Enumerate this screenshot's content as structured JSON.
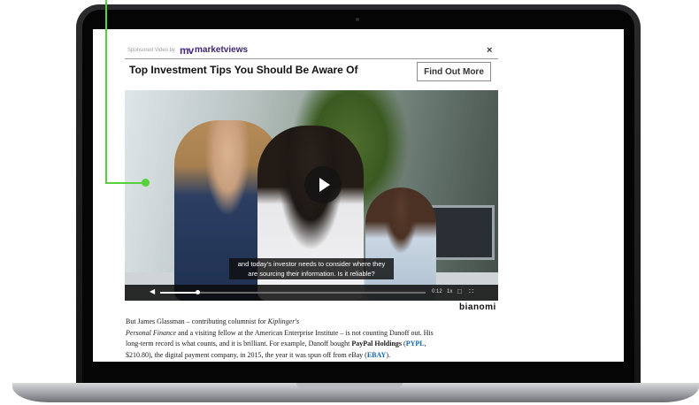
{
  "ad": {
    "sponsored_label": "Sponsored Video by",
    "logo_mark": "mv",
    "brand_name": "marketviews",
    "close_symbol": "×",
    "headline": "Top Investment Tips You Should Be Aware Of",
    "cta_label": "Find Out More",
    "caption_line1": "and today's investor needs to consider where they",
    "caption_line2": "are sourcing their information. Is it reliable?",
    "player": {
      "time": "0:12",
      "speed": "1x",
      "progress": 0.14
    },
    "provider_logo": "bianomi"
  },
  "article": {
    "line1_prefix": "But James Glassman – contributing columnist for ",
    "line1_italic": "Kiplinger's",
    "line2_italic": "Personal Finance",
    "line2_suffix": " and a visiting fellow at the American Enterprise Institute – is not counting Danoff out. His",
    "line3": "long-term record is what counts, and it is brilliant. For example, Danoff bought ",
    "line3_company": "PayPal Holdings",
    "line3_open": " (",
    "line3_ticker": "PYPL",
    "line3_close": ",",
    "line4": "$210.80), the digital payment company, in 2015, the year it was spun off from eBay (",
    "line4_ticker": "EBAY",
    "line4_close": ")."
  },
  "colors": {
    "annotation_green": "#58d03c",
    "brand_purple": "#4b2a8a",
    "ticker_blue": "#1565b0"
  }
}
